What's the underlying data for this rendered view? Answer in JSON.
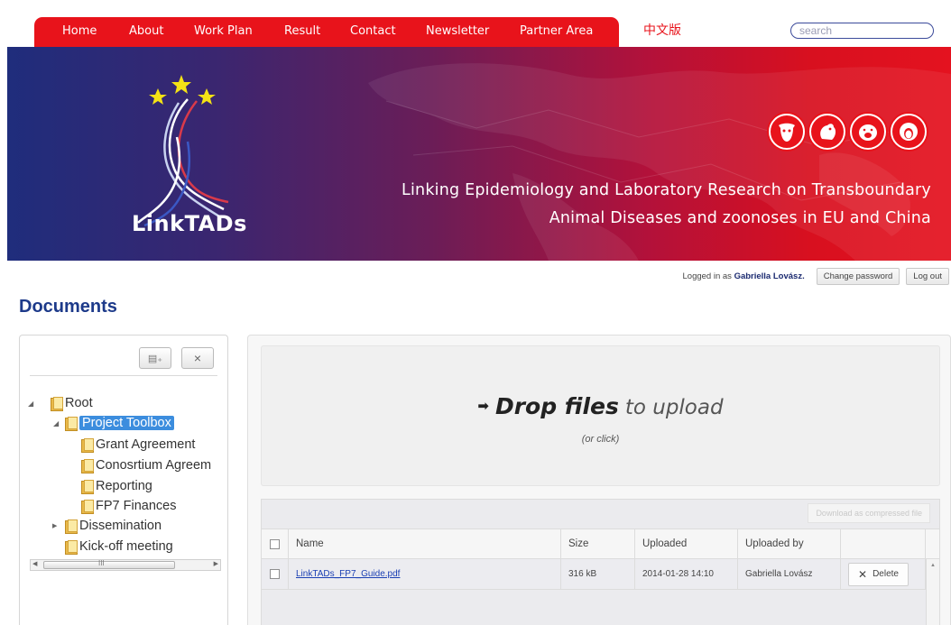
{
  "nav": {
    "items": [
      "Home",
      "About",
      "Work Plan",
      "Result",
      "Contact",
      "Newsletter",
      "Partner Area"
    ],
    "chinese_version": "中文版",
    "search_placeholder": "search"
  },
  "banner": {
    "logo_text": "LinkTADs",
    "tagline_line1": "Linking Epidemiology and Laboratory Research on Transboundary",
    "tagline_line2": "Animal Diseases and zoonoses in EU and China",
    "animal_icons": [
      "cow-icon",
      "chicken-icon",
      "pig-icon",
      "sheep-icon"
    ]
  },
  "user": {
    "logged_prefix": "Logged in as",
    "name": "Gabriella Lovász.",
    "change_password": "Change password",
    "log_out": "Log out"
  },
  "page": {
    "title": "Documents"
  },
  "tree": {
    "toolbar": {
      "new_folder": "new-folder-icon",
      "delete": "×"
    },
    "nodes": [
      {
        "label": "Root",
        "level": 0,
        "expanded": true
      },
      {
        "label": "Project Toolbox",
        "level": 1,
        "expanded": true,
        "selected": true
      },
      {
        "label": "Grant Agreement",
        "level": 2
      },
      {
        "label": "Conosrtium Agreem",
        "level": 2
      },
      {
        "label": "Reporting",
        "level": 2
      },
      {
        "label": "FP7 Finances",
        "level": 2
      },
      {
        "label": "Dissemination",
        "level": 1,
        "expanded": false
      },
      {
        "label": "Kick-off meeting",
        "level": 1
      }
    ],
    "scroll_glyph": "III"
  },
  "upload": {
    "arrow": "➡",
    "strong": "Drop files",
    "rest": "to upload",
    "sub": "(or click)"
  },
  "files": {
    "download_button": "Download as compressed file",
    "columns": [
      "Name",
      "Size",
      "Uploaded",
      "Uploaded by"
    ],
    "rows": [
      {
        "name": "LinkTADs_FP7_Guide.pdf",
        "size": "316 kB",
        "uploaded": "2014-01-28 14:10",
        "uploaded_by": "Gabriella Lovász",
        "action": "Delete"
      }
    ]
  },
  "colors": {
    "nav_red": "#e8131b",
    "title_blue": "#1d3a8a",
    "selected_blue": "#3c8dde"
  }
}
